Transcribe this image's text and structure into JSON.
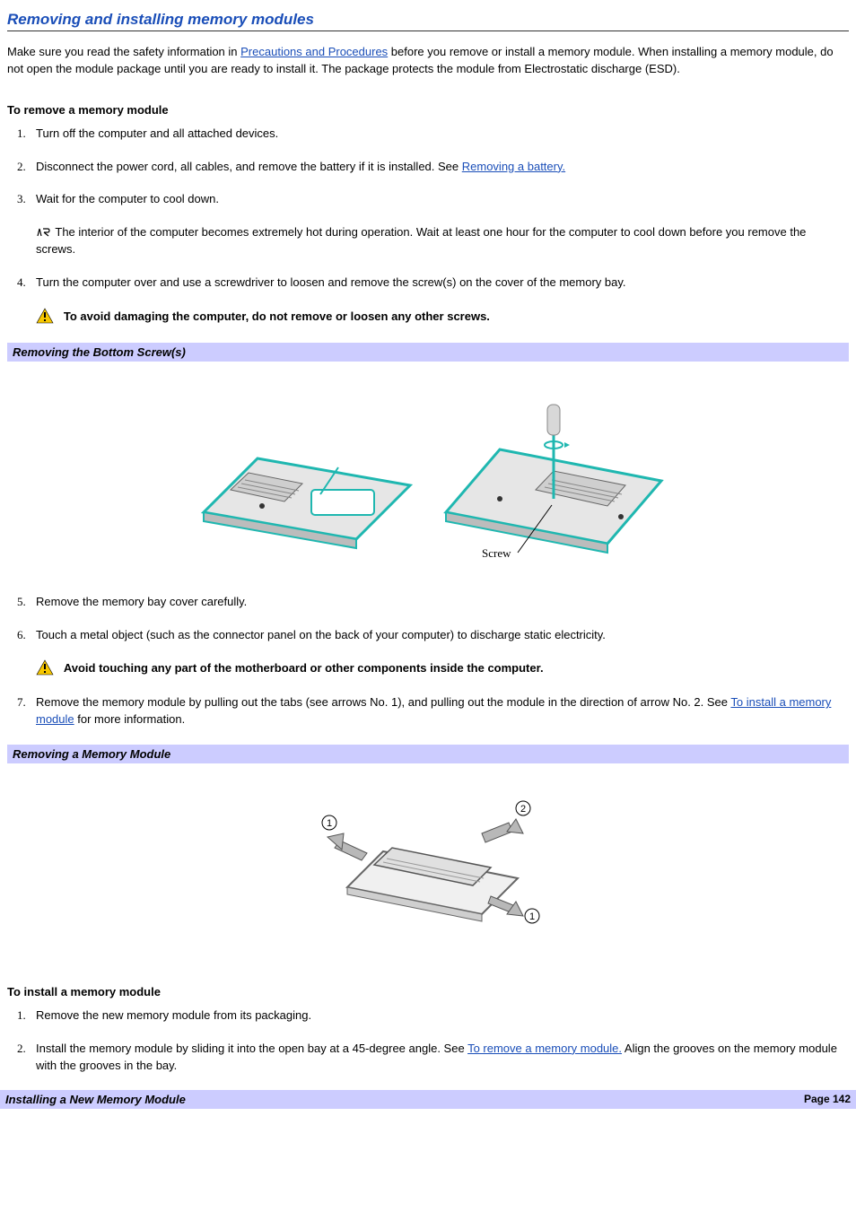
{
  "title": "Removing and installing memory modules",
  "intro_prefix": "Make sure you read the safety information in ",
  "intro_link": "Precautions and Procedures",
  "intro_suffix": " before you remove or install a memory module. When installing a memory module, do not open the module package until you are ready to install it. The package protects the module from Electrostatic discharge (ESD).",
  "remove_heading": "To remove a memory module",
  "remove_steps": {
    "s1": "Turn off the computer and all attached devices.",
    "s2_prefix": "Disconnect the power cord, all cables, and remove the battery if it is installed. See ",
    "s2_link": "Removing a battery.",
    "s3": "Wait for the computer to cool down.",
    "s3_note": " The interior of the computer becomes extremely hot during operation. Wait at least one hour for the computer to cool down before you remove the screws.",
    "s4": "Turn the computer over and use a screwdriver to loosen and remove the screw(s) on the cover of the memory bay.",
    "s4_warn": "To avoid damaging the computer, do not remove or loosen any other screws.",
    "s5": "Remove the memory bay cover carefully.",
    "s6": "Touch a metal object (such as the connector panel on the back of your computer) to discharge static electricity.",
    "s6_warn": "Avoid touching any part of the motherboard or other components inside the computer.",
    "s7_prefix": "Remove the memory module by pulling out the tabs (see arrows No. 1), and pulling out the module in the direction of arrow No. 2. See ",
    "s7_link": "To install a memory module",
    "s7_suffix": " for more information."
  },
  "fig1_caption": "Removing the Bottom Screw(s)",
  "fig1_label": "Screw",
  "fig2_caption": "Removing a Memory Module",
  "install_heading": "To install a memory module",
  "install_steps": {
    "s1": "Remove the new memory module from its packaging.",
    "s2_prefix": "Install the memory module by sliding it into the open bay at a 45-degree angle. See ",
    "s2_link": "To remove a memory module.",
    "s2_suffix": " Align the grooves on the memory module with the grooves in the bay."
  },
  "footer_caption": "Installing a New Memory Module",
  "footer_page": "Page 142"
}
